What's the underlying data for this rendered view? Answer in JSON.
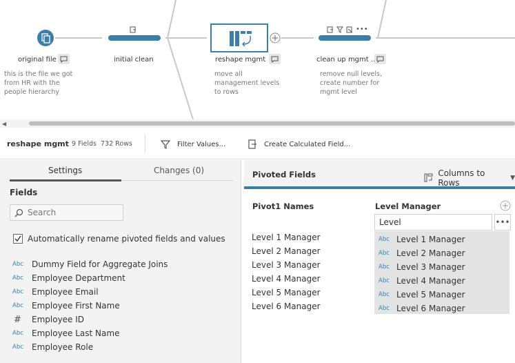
{
  "flow": {
    "nodes": [
      {
        "label": "original file",
        "desc": "this is the file we got\nfrom HR with the\npeople hierarchy"
      },
      {
        "label": "initial clean",
        "desc": ""
      },
      {
        "label": "reshape mgmt",
        "desc": "move all\nmanagement levels\nto rows"
      },
      {
        "label": "clean up mgmt ...",
        "desc": "remove null levels,\ncreate number for\nmgmt level"
      }
    ],
    "accent_color": "#3d7ea6"
  },
  "toolbar": {
    "step_name": "reshape mgmt",
    "fields_count": "9 Fields",
    "rows_count": "732 Rows",
    "filter_label": "Filter Values...",
    "calc_label": "Create Calculated Field..."
  },
  "left": {
    "tabs": {
      "settings": "Settings",
      "changes": "Changes (0)"
    },
    "fields_heading": "Fields",
    "search_placeholder": "Search",
    "auto_rename_label": "Automatically rename pivoted fields and values",
    "fields": [
      {
        "type": "Abc",
        "name": "Dummy Field for Aggregate Joins"
      },
      {
        "type": "Abc",
        "name": "Employee Department"
      },
      {
        "type": "Abc",
        "name": "Employee Email"
      },
      {
        "type": "Abc",
        "name": "Employee First Name"
      },
      {
        "type": "#",
        "name": "Employee ID"
      },
      {
        "type": "Abc",
        "name": "Employee Last Name"
      },
      {
        "type": "Abc",
        "name": "Employee Role"
      }
    ]
  },
  "right": {
    "pivoted_title": "Pivoted Fields",
    "mode_label": "Columns to Rows",
    "names_heading": "Pivot1 Names",
    "values_heading": "Level Manager",
    "values_input": "Level",
    "pivot_names": [
      "Level 1 Manager",
      "Level 2 Manager",
      "Level 3 Manager",
      "Level 4 Manager",
      "Level 5 Manager",
      "Level 6 Manager"
    ],
    "value_type": "Abc",
    "values": [
      "Level 1 Manager",
      "Level 2 Manager",
      "Level 3 Manager",
      "Level 4 Manager",
      "Level 5 Manager",
      "Level 6 Manager"
    ]
  }
}
